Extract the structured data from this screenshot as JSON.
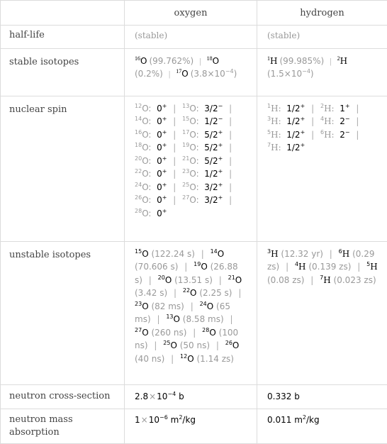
{
  "header": {
    "corner": "",
    "columns": [
      "oxygen",
      "hydrogen"
    ]
  },
  "rows": {
    "half_life": {
      "label": "half-life",
      "oxygen": "(stable)",
      "hydrogen": "(stable)"
    },
    "stable_isotopes": {
      "label": "stable isotopes",
      "oxygen": [
        {
          "mass": "16",
          "symbol": "O",
          "abundance": "(99.762%)"
        },
        {
          "mass": "18",
          "symbol": "O",
          "abundance": "(0.2%)"
        },
        {
          "mass": "17",
          "symbol": "O",
          "abundance_mantissa": "(3.8",
          "abundance_times": "×",
          "abundance_base": "10",
          "abundance_exp": "−4",
          "abundance_close": ")"
        }
      ],
      "hydrogen": [
        {
          "mass": "1",
          "symbol": "H",
          "abundance": "(99.985%)"
        },
        {
          "mass": "2",
          "symbol": "H",
          "abundance_mantissa": "(1.5",
          "abundance_times": "×",
          "abundance_base": "10",
          "abundance_exp": "−4",
          "abundance_close": ")"
        }
      ]
    },
    "nuclear_spin": {
      "label": "nuclear spin",
      "oxygen": [
        {
          "mass": "12",
          "symbol": "O",
          "spin": "0",
          "parity": "+"
        },
        {
          "mass": "13",
          "symbol": "O",
          "spin": "3/2",
          "parity": "−"
        },
        {
          "mass": "14",
          "symbol": "O",
          "spin": "0",
          "parity": "+"
        },
        {
          "mass": "15",
          "symbol": "O",
          "spin": "1/2",
          "parity": "−"
        },
        {
          "mass": "16",
          "symbol": "O",
          "spin": "0",
          "parity": "+"
        },
        {
          "mass": "17",
          "symbol": "O",
          "spin": "5/2",
          "parity": "+"
        },
        {
          "mass": "18",
          "symbol": "O",
          "spin": "0",
          "parity": "+"
        },
        {
          "mass": "19",
          "symbol": "O",
          "spin": "5/2",
          "parity": "+"
        },
        {
          "mass": "20",
          "symbol": "O",
          "spin": "0",
          "parity": "+"
        },
        {
          "mass": "21",
          "symbol": "O",
          "spin": "5/2",
          "parity": "+"
        },
        {
          "mass": "22",
          "symbol": "O",
          "spin": "0",
          "parity": "+"
        },
        {
          "mass": "23",
          "symbol": "O",
          "spin": "1/2",
          "parity": "+"
        },
        {
          "mass": "24",
          "symbol": "O",
          "spin": "0",
          "parity": "+"
        },
        {
          "mass": "25",
          "symbol": "O",
          "spin": "3/2",
          "parity": "+"
        },
        {
          "mass": "26",
          "symbol": "O",
          "spin": "0",
          "parity": "+"
        },
        {
          "mass": "27",
          "symbol": "O",
          "spin": "3/2",
          "parity": "+"
        },
        {
          "mass": "28",
          "symbol": "O",
          "spin": "0",
          "parity": "+"
        }
      ],
      "hydrogen": [
        {
          "mass": "1",
          "symbol": "H",
          "spin": "1/2",
          "parity": "+"
        },
        {
          "mass": "2",
          "symbol": "H",
          "spin": "1",
          "parity": "+"
        },
        {
          "mass": "3",
          "symbol": "H",
          "spin": "1/2",
          "parity": "+"
        },
        {
          "mass": "4",
          "symbol": "H",
          "spin": "2",
          "parity": "−"
        },
        {
          "mass": "5",
          "symbol": "H",
          "spin": "1/2",
          "parity": "+"
        },
        {
          "mass": "6",
          "symbol": "H",
          "spin": "2",
          "parity": "−"
        },
        {
          "mass": "7",
          "symbol": "H",
          "spin": "1/2",
          "parity": "+"
        }
      ]
    },
    "unstable_isotopes": {
      "label": "unstable isotopes",
      "oxygen": [
        {
          "mass": "15",
          "symbol": "O",
          "half_life": "(122.24 s)"
        },
        {
          "mass": "14",
          "symbol": "O",
          "half_life": "(70.606 s)"
        },
        {
          "mass": "19",
          "symbol": "O",
          "half_life": "(26.88 s)"
        },
        {
          "mass": "20",
          "symbol": "O",
          "half_life": "(13.51 s)"
        },
        {
          "mass": "21",
          "symbol": "O",
          "half_life": "(3.42 s)"
        },
        {
          "mass": "22",
          "symbol": "O",
          "half_life": "(2.25 s)"
        },
        {
          "mass": "23",
          "symbol": "O",
          "half_life": "(82 ms)"
        },
        {
          "mass": "24",
          "symbol": "O",
          "half_life": "(65 ms)"
        },
        {
          "mass": "13",
          "symbol": "O",
          "half_life": "(8.58 ms)"
        },
        {
          "mass": "27",
          "symbol": "O",
          "half_life": "(260 ns)"
        },
        {
          "mass": "28",
          "symbol": "O",
          "half_life": "(100 ns)"
        },
        {
          "mass": "25",
          "symbol": "O",
          "half_life": "(50 ns)"
        },
        {
          "mass": "26",
          "symbol": "O",
          "half_life": "(40 ns)"
        },
        {
          "mass": "12",
          "symbol": "O",
          "half_life": "(1.14 zs)"
        }
      ],
      "hydrogen": [
        {
          "mass": "3",
          "symbol": "H",
          "half_life": "(12.32 yr)"
        },
        {
          "mass": "6",
          "symbol": "H",
          "half_life": "(0.29 zs)"
        },
        {
          "mass": "4",
          "symbol": "H",
          "half_life": "(0.139 zs)"
        },
        {
          "mass": "5",
          "symbol": "H",
          "half_life": "(0.08 zs)"
        },
        {
          "mass": "7",
          "symbol": "H",
          "half_life": "(0.023 zs)"
        }
      ]
    },
    "neutron_cross_section": {
      "label": "neutron cross-section",
      "oxygen": {
        "mantissa": "2.8",
        "times": "×",
        "base": "10",
        "exp": "−4",
        "unit": "b"
      },
      "hydrogen": {
        "value": "0.332",
        "unit": "b"
      }
    },
    "neutron_mass_absorption": {
      "label": "neutron mass absorption",
      "oxygen": {
        "mantissa": "1",
        "times": "×",
        "base": "10",
        "exp": "−6",
        "unit_base": "m",
        "unit_exp": "2",
        "unit_rest": "/kg"
      },
      "hydrogen": {
        "value": "0.011",
        "unit_base": "m",
        "unit_exp": "2",
        "unit_rest": "/kg"
      }
    }
  },
  "separator": "|"
}
